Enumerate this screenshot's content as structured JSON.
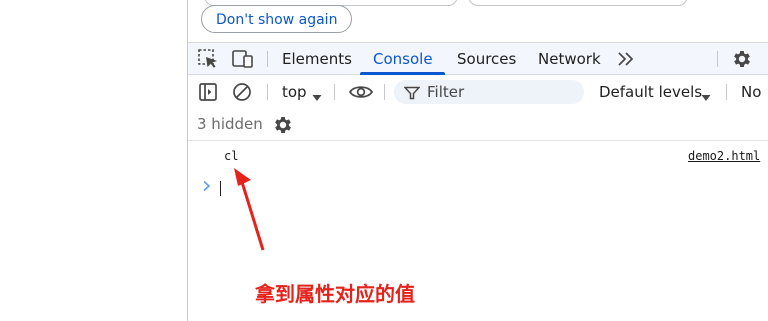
{
  "banner": {
    "dont_show_label": "Don't show again"
  },
  "tabs": [
    {
      "label": "Elements"
    },
    {
      "label": "Console"
    },
    {
      "label": "Sources"
    },
    {
      "label": "Network"
    }
  ],
  "toolbar": {
    "context": "top",
    "filter_placeholder": "Filter",
    "levels": "Default levels",
    "issues": "No"
  },
  "hidden_count": "3 hidden",
  "console_log": {
    "text": "cl",
    "source": "demo2.html"
  },
  "annotation": {
    "text": "拿到属性对应的值",
    "color": "#e5231b"
  },
  "colors": {
    "accent": "#0b57d0",
    "tabbar_bg": "#f3f6fc"
  }
}
